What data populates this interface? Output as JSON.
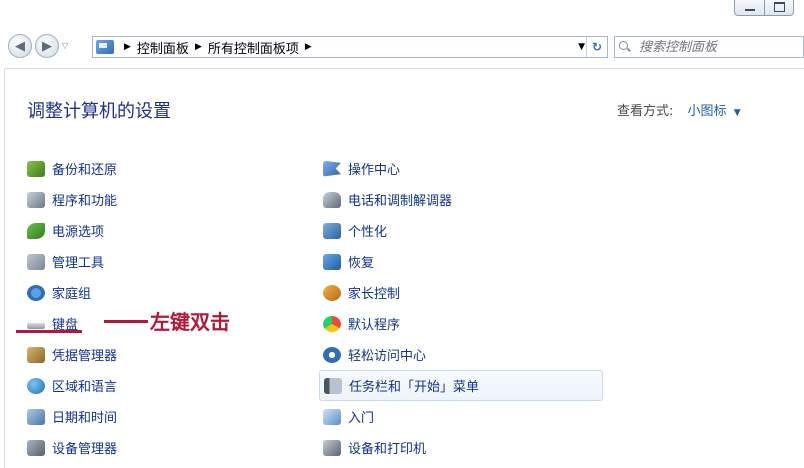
{
  "window": {
    "controls": [
      "minimize",
      "maximize"
    ]
  },
  "address_bar": {
    "icon": "control-panel-icon",
    "crumbs": [
      "控制面板",
      "所有控制面板项"
    ],
    "search_placeholder": "搜索控制面板"
  },
  "header": {
    "title": "调整计算机的设置",
    "view_by_label": "查看方式:",
    "view_by_value": "小图标"
  },
  "left_items": [
    {
      "label": "备份和还原",
      "icon": "backup-restore-icon"
    },
    {
      "label": "程序和功能",
      "icon": "programs-features-icon"
    },
    {
      "label": "电源选项",
      "icon": "power-options-icon"
    },
    {
      "label": "管理工具",
      "icon": "admin-tools-icon"
    },
    {
      "label": "家庭组",
      "icon": "homegroup-icon"
    },
    {
      "label": "键盘",
      "icon": "keyboard-icon"
    },
    {
      "label": "凭据管理器",
      "icon": "credential-manager-icon"
    },
    {
      "label": "区域和语言",
      "icon": "region-language-icon"
    },
    {
      "label": "日期和时间",
      "icon": "date-time-icon"
    },
    {
      "label": "设备管理器",
      "icon": "device-manager-icon"
    }
  ],
  "right_items": [
    {
      "label": "操作中心",
      "icon": "action-center-icon"
    },
    {
      "label": "电话和调制解调器",
      "icon": "phone-modem-icon"
    },
    {
      "label": "个性化",
      "icon": "personalization-icon"
    },
    {
      "label": "恢复",
      "icon": "recovery-icon"
    },
    {
      "label": "家长控制",
      "icon": "parental-controls-icon"
    },
    {
      "label": "默认程序",
      "icon": "default-programs-icon"
    },
    {
      "label": "轻松访问中心",
      "icon": "ease-of-access-icon"
    },
    {
      "label": "任务栏和「开始」菜单",
      "icon": "taskbar-start-menu-icon",
      "selected": true
    },
    {
      "label": "入门",
      "icon": "getting-started-icon"
    },
    {
      "label": "设备和打印机",
      "icon": "devices-printers-icon"
    }
  ],
  "annotation": {
    "text": "左键双击",
    "color": "#b01a3a",
    "target": "键盘"
  }
}
